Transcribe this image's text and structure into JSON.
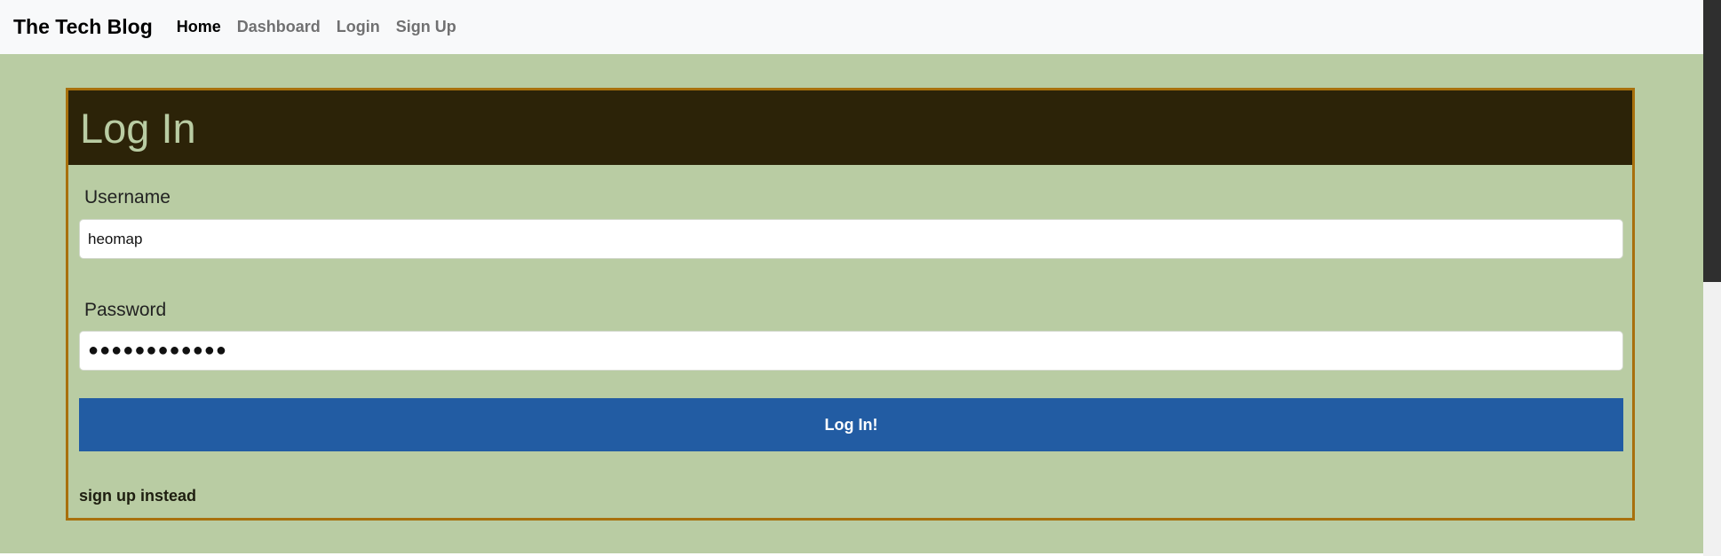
{
  "nav": {
    "brand": "The Tech Blog",
    "links": [
      {
        "label": "Home",
        "active": true
      },
      {
        "label": "Dashboard",
        "active": false
      },
      {
        "label": "Login",
        "active": false
      },
      {
        "label": "Sign Up",
        "active": false
      }
    ]
  },
  "login_card": {
    "title": "Log In",
    "username_label": "Username",
    "username_value": "heomap",
    "password_label": "Password",
    "password_value": "●●●●●●●●●●●●",
    "submit_label": "Log In!",
    "signup_link": "sign up instead"
  },
  "colors": {
    "page_background": "#b9cca3",
    "card_header": "#2c2308",
    "card_border": "#a8700d",
    "button": "#225ca3",
    "navbar": "#f8f9fa"
  }
}
